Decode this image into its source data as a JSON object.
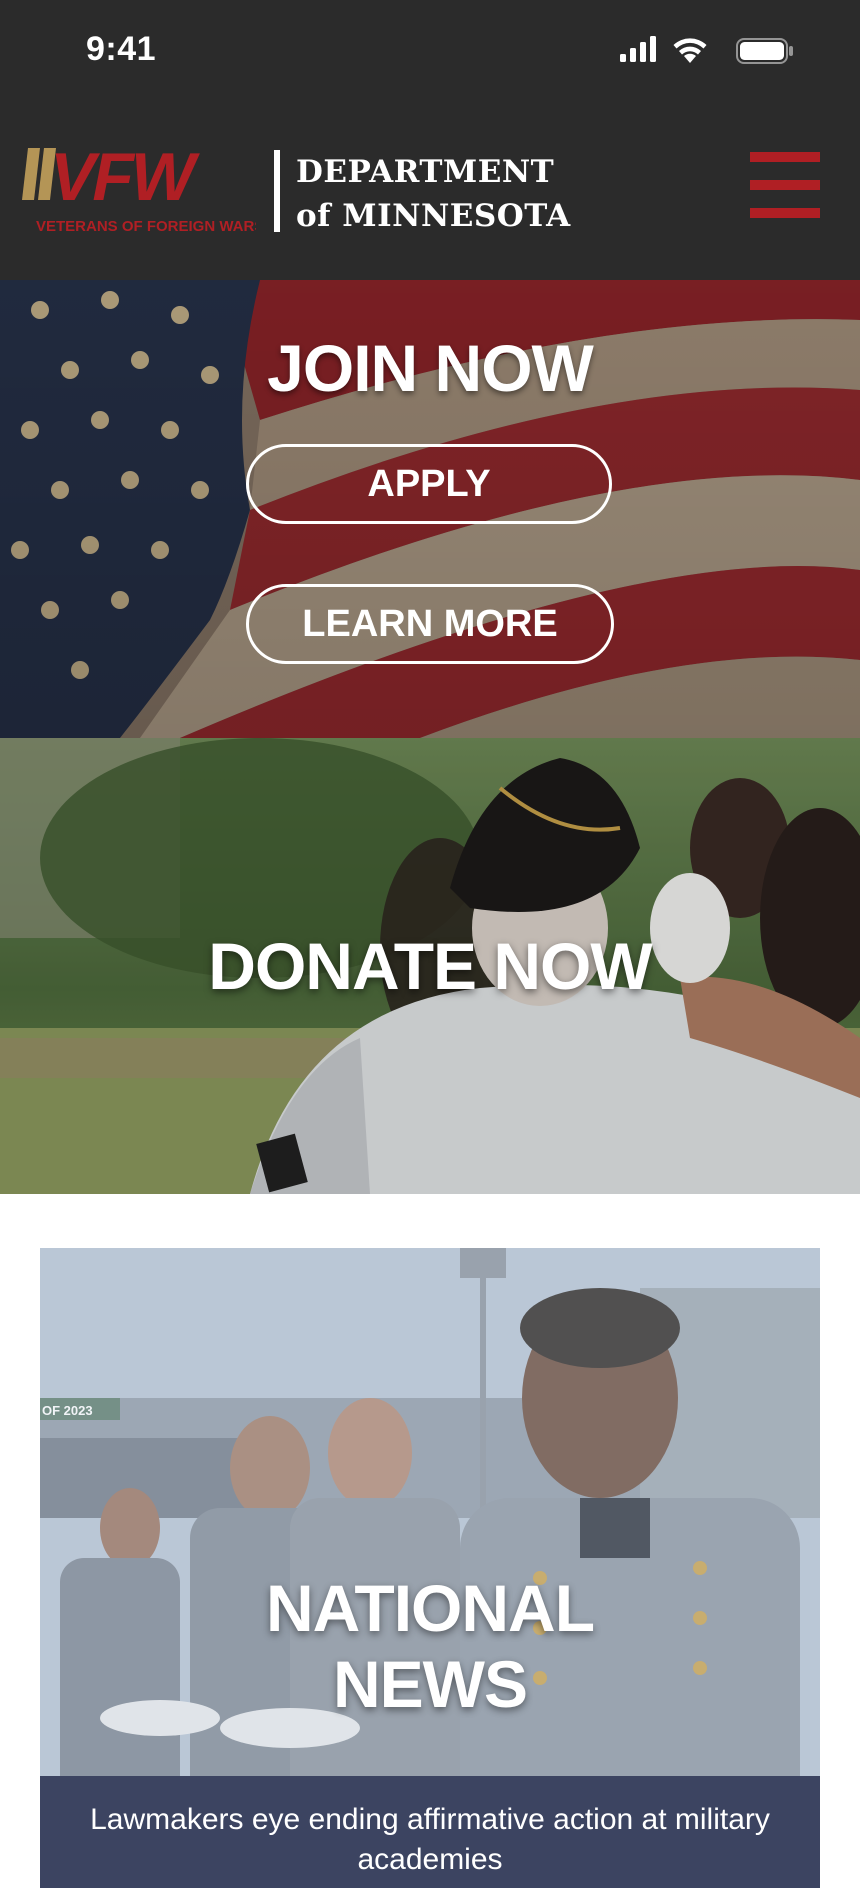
{
  "status_bar": {
    "time": "9:41"
  },
  "header": {
    "logo_text": "VFW",
    "logo_tagline": "VETERANS OF FOREIGN WARS.",
    "dept_line1": "DEPARTMENT",
    "dept_line2": "of MINNESOTA",
    "menu_icon": "hamburger-menu-icon"
  },
  "join": {
    "title": "JOIN NOW",
    "apply_label": "APPLY",
    "learn_more_label": "LEARN MORE"
  },
  "donate": {
    "title": "DONATE NOW"
  },
  "news": {
    "title_line1": "NATIONAL",
    "title_line2": "NEWS",
    "sign_text": "OF 2023",
    "caption": "Lawmakers eye ending affirmative action at military academies"
  },
  "colors": {
    "header_bg": "#2b2b2b",
    "brand_red": "#b01f24",
    "brand_gold": "#b49556",
    "caption_bg": "#3c4461"
  }
}
